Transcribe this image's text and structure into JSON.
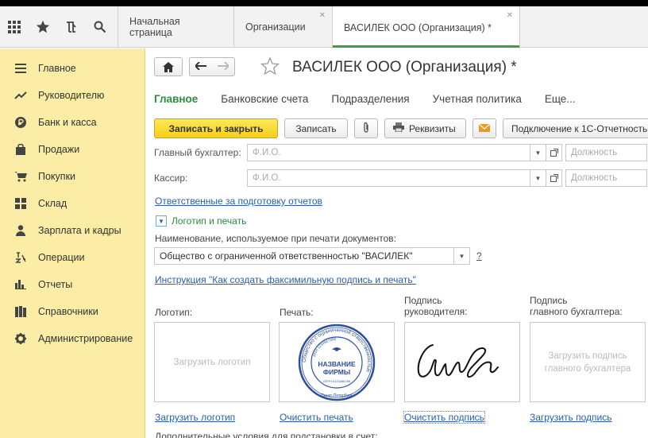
{
  "topbar": {
    "icons": [
      "apps-grid-icon",
      "star-icon",
      "history-icon",
      "search-icon"
    ],
    "tabs": [
      {
        "label": "Начальная страница",
        "closable": false
      },
      {
        "label": "Организации",
        "closable": true
      },
      {
        "label": "ВАСИЛЕК ООО (Организация) *",
        "closable": true,
        "active": true
      }
    ]
  },
  "sidebar": {
    "items": [
      {
        "label": "Главное",
        "icon": "menu-lines-icon"
      },
      {
        "label": "Руководителю",
        "icon": "trend-chart-icon"
      },
      {
        "label": "Банк и касса",
        "icon": "ruble-coin-icon"
      },
      {
        "label": "Продажи",
        "icon": "shopping-bag-icon"
      },
      {
        "label": "Покупки",
        "icon": "shopping-cart-icon"
      },
      {
        "label": "Склад",
        "icon": "warehouse-grid-icon"
      },
      {
        "label": "Зарплата и кадры",
        "icon": "person-icon"
      },
      {
        "label": "Операции",
        "icon": "operations-icon"
      },
      {
        "label": "Отчеты",
        "icon": "bar-chart-icon"
      },
      {
        "label": "Справочники",
        "icon": "books-icon"
      },
      {
        "label": "Администрирование",
        "icon": "gear-icon"
      }
    ]
  },
  "main": {
    "title": "ВАСИЛЕК ООО (Организация) *",
    "sections": [
      "Главное",
      "Банковские счета",
      "Подразделения",
      "Учетная политика",
      "Еще..."
    ],
    "toolbar": {
      "save_close": "Записать и закрыть",
      "save": "Записать",
      "details": "Реквизиты",
      "connect": "Подключение к 1С-Отчетность"
    },
    "chief_accountant": {
      "label": "Главный бухгалтер:",
      "placeholder": "Ф.И.О.",
      "position_placeholder": "Должность"
    },
    "cashier": {
      "label": "Кассир:",
      "placeholder": "Ф.И.О.",
      "position_placeholder": "Должность"
    },
    "responsible_link": "Ответственные за подготовку отчетов",
    "logo_section": "Логотип и печать",
    "print_name_label": "Наименование, используемое при печати документов:",
    "print_name_value": "Общество с ограниченной ответственностью \"ВАСИЛЕК\"",
    "help": "?",
    "instruction_link": "Инструкция \"Как создать факсимильную подпись и печать\"",
    "images": {
      "logo": {
        "caption": "Логотип:",
        "empty_text": "Загрузить логотип",
        "link": "Загрузить логотип"
      },
      "stamp": {
        "caption": "Печать:",
        "link": "Очистить печать",
        "ring_text": "Общество с ограниченной ответственностью",
        "center_line1": "НАЗВАНИЕ",
        "center_line2": "ФИРМЫ",
        "inn": "ИНН 1234567890",
        "ogrn": "ОГРН 0123456789",
        "city": "Санкт-Петербург"
      },
      "director_signature": {
        "caption_line1": "Подпись",
        "caption_line2": "руководителя:",
        "link": "Очистить подпись"
      },
      "accountant_signature": {
        "caption_line1": "Подпись",
        "caption_line2": "главного бухгалтера:",
        "empty_line1": "Загрузить подпись",
        "empty_line2": "главного бухгалтера",
        "link": "Загрузить подпись"
      }
    },
    "additional_conditions": "Дополнительные условия для подстановки в счет:"
  },
  "colors": {
    "sidebar": "#fbeda5",
    "primary_button": "#f5cf17",
    "active_section": "#2e8b3d",
    "link": "#2a5db0",
    "stamp": "#2b4f9e"
  }
}
